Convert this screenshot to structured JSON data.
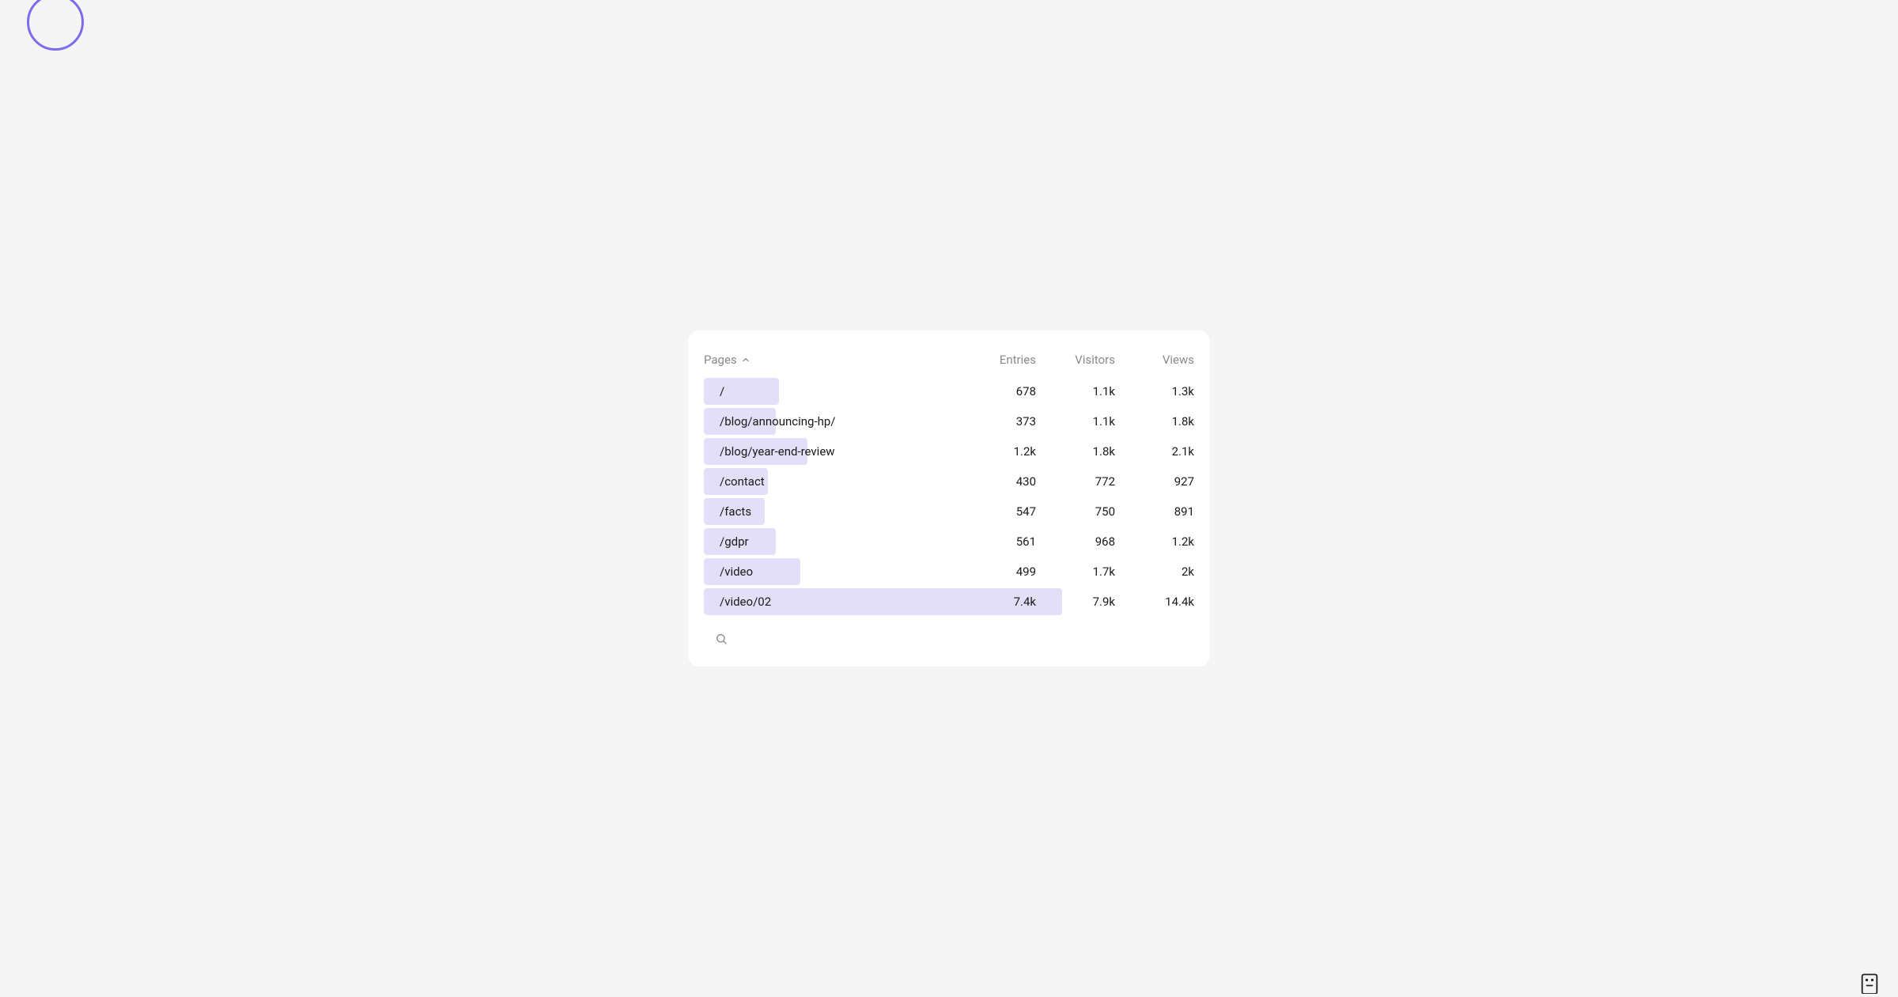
{
  "card": {
    "header": {
      "pages_label": "Pages",
      "entries_label": "Entries",
      "visitors_label": "Visitors",
      "views_label": "Views",
      "sort_direction": "asc"
    },
    "rows": [
      {
        "path": "/",
        "entries": "678",
        "visitors": "1.1k",
        "views": "1.3k",
        "bar_pct": 21
      },
      {
        "path": "/blog/announcing-hp/",
        "entries": "373",
        "visitors": "1.1k",
        "views": "1.8k",
        "bar_pct": 20
      },
      {
        "path": "/blog/year-end-review",
        "entries": "1.2k",
        "visitors": "1.8k",
        "views": "2.1k",
        "bar_pct": 29
      },
      {
        "path": "/contact",
        "entries": "430",
        "visitors": "772",
        "views": "927",
        "bar_pct": 18
      },
      {
        "path": "/facts",
        "entries": "547",
        "visitors": "750",
        "views": "891",
        "bar_pct": 17
      },
      {
        "path": "/gdpr",
        "entries": "561",
        "visitors": "968",
        "views": "1.2k",
        "bar_pct": 20
      },
      {
        "path": "/video",
        "entries": "499",
        "visitors": "1.7k",
        "views": "2k",
        "bar_pct": 27
      },
      {
        "path": "/video/02",
        "entries": "7.4k",
        "visitors": "7.9k",
        "views": "14.4k",
        "bar_pct": 100
      }
    ]
  },
  "colors": {
    "bar": "#e4dff8",
    "accent": "#7c6cf0",
    "text_muted": "#8a8a8a",
    "text": "#1a1a1a"
  }
}
